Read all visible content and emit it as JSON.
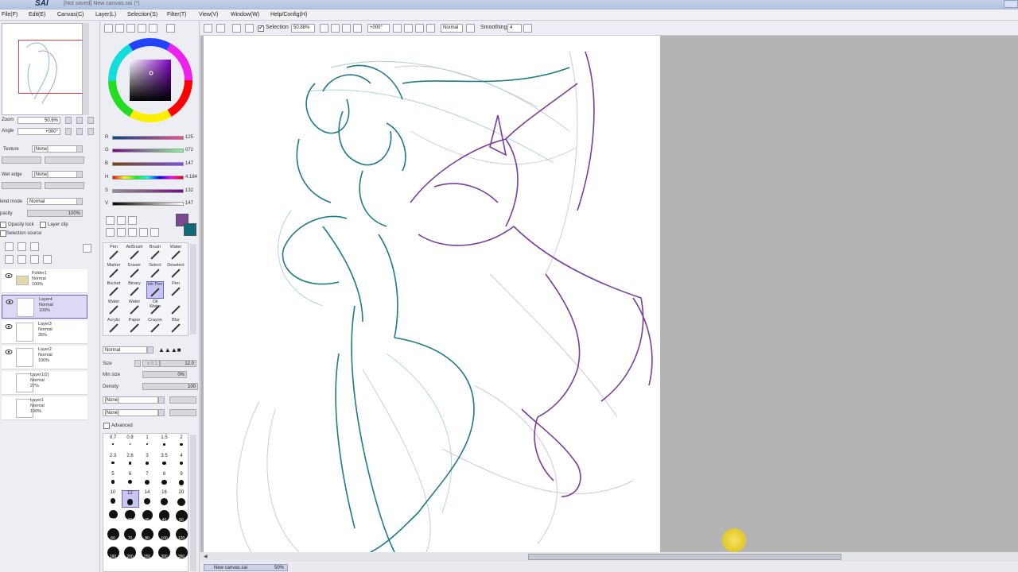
{
  "window": {
    "logo": "SAI",
    "title": "[Not saved] New canvas.sai (*)"
  },
  "menu": [
    "File(F)",
    "Edit(E)",
    "Canvas(C)",
    "Layer(L)",
    "Selection(S)",
    "Filter(T)",
    "View(V)",
    "Window(W)",
    "Help/Config(H)"
  ],
  "toolbar": {
    "selection_label": "Selection",
    "zoom_value": "50.88%",
    "angle_value": "+000°",
    "blend_value": "Normal",
    "smoothing_label": "Smoothing",
    "smoothing_value": "4"
  },
  "navigator": {
    "zoom_label": "Zoom",
    "zoom_value": "50.6%",
    "angle_label": "Angle",
    "angle_value": "+000°"
  },
  "texture": {
    "texture_label": "Texture",
    "texture_value": "[None]",
    "wet_edge_label": "Wet edge",
    "wet_edge_value": "[None]",
    "blend_mode_label": "lend mode",
    "blend_mode_value": "Normal",
    "opacity_label": "pacity",
    "opacity_value": "100%",
    "opacity_lock_label": "Opacity lock",
    "layer_clip_label": "Layer clip",
    "selection_source_label": "Selection source"
  },
  "layers": [
    {
      "name": "Folder1",
      "mode": "Normal",
      "opacity": "100%",
      "selected": false
    },
    {
      "name": "Layer4",
      "mode": "Normal",
      "opacity": "100%",
      "selected": true
    },
    {
      "name": "Layer3",
      "mode": "Normal",
      "opacity": "35%",
      "selected": false
    },
    {
      "name": "Layer2",
      "mode": "Normal",
      "opacity": "100%",
      "selected": false
    },
    {
      "name": "Layer1(2)",
      "mode": "Normal",
      "opacity": "27%",
      "selected": false
    },
    {
      "name": "Layer1",
      "mode": "Normal",
      "opacity": "100%",
      "selected": false
    }
  ],
  "color_sliders": [
    {
      "label": "R",
      "value": "125"
    },
    {
      "label": "G",
      "value": "072"
    },
    {
      "label": "B",
      "value": "147"
    },
    {
      "label": "H",
      "value": "4.184"
    },
    {
      "label": "S",
      "value": "132"
    },
    {
      "label": "V",
      "value": "147"
    }
  ],
  "colors": {
    "primary": "#7d4893",
    "secondary": "#0f6a7a",
    "teal_line": "#1f7a8a",
    "purple_line": "#7b3c9e",
    "sel_highlight": "#c9c5f2"
  },
  "tools": [
    {
      "label": "Pen"
    },
    {
      "label": "AirBrush"
    },
    {
      "label": "Brush"
    },
    {
      "label": "Water"
    },
    {
      "label": "Marker"
    },
    {
      "label": "Eraser"
    },
    {
      "label": "Select"
    },
    {
      "label": "Deselect"
    },
    {
      "label": "Bucket"
    },
    {
      "label": "Binary"
    },
    {
      "label": "Ink Pen"
    },
    {
      "label": "Pen"
    },
    {
      "label": "Water"
    },
    {
      "label": "Water"
    },
    {
      "label": "Oil Water"
    },
    {
      "label": ""
    },
    {
      "label": "Acrylic"
    },
    {
      "label": "Paper"
    },
    {
      "label": "Crayon"
    },
    {
      "label": "Blur"
    }
  ],
  "brush_settings": {
    "mode": "Normal",
    "size_label": "Size",
    "size_mult": "x 0.1",
    "size_value": "12.0",
    "min_size_label": "Min size",
    "min_size_value": "0%",
    "density_label": "Density",
    "density_value": "100",
    "shape1": "[None]",
    "shape2": "[None]",
    "advanced_label": "Advanced"
  },
  "brush_sizes": [
    "0.7",
    "0.8",
    "1",
    "1.5",
    "2",
    "2.3",
    "2.6",
    "3",
    "3.5",
    "4",
    "5",
    "6",
    "7",
    "8",
    "9",
    "10",
    "12",
    "14",
    "16",
    "20",
    "25",
    "30",
    "35",
    "40",
    "50",
    "60",
    "70",
    "80",
    "100",
    "120",
    "160",
    "200",
    "250",
    "300",
    "350"
  ],
  "status": {
    "file": "New canvas.sai",
    "zoom": "50%"
  }
}
